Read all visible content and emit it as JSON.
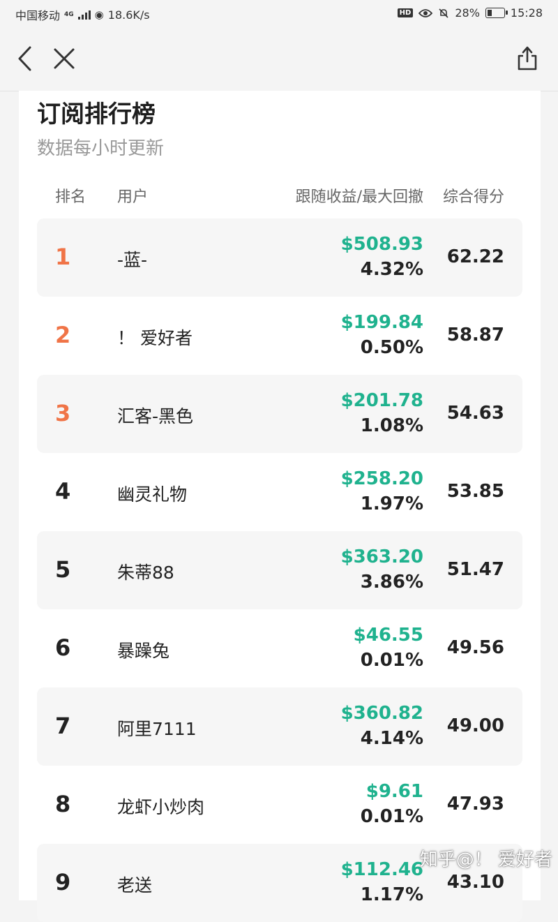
{
  "status_bar": {
    "carrier": "中国移动",
    "network_type": "4G",
    "speed": "18.6K/s",
    "hd_badge": "HD",
    "battery": "28%",
    "time": "15:28"
  },
  "nav": {
    "back_icon": "chevron-left-icon",
    "close_icon": "close-icon",
    "share_icon": "share-icon"
  },
  "page": {
    "title": "订阅排行榜",
    "subtitle": "数据每小时更新"
  },
  "table": {
    "headers": {
      "rank": "排名",
      "user": "用户",
      "perf": "跟随收益/最大回撤",
      "score": "综合得分"
    },
    "rows": [
      {
        "rank": "1",
        "user": "-蓝-",
        "gain": "$508.93",
        "drawdown": "4.32%",
        "score": "62.22"
      },
      {
        "rank": "2",
        "user": "！ 爱好者",
        "gain": "$199.84",
        "drawdown": "0.50%",
        "score": "58.87"
      },
      {
        "rank": "3",
        "user": "汇客-黑色",
        "gain": "$201.78",
        "drawdown": "1.08%",
        "score": "54.63"
      },
      {
        "rank": "4",
        "user": "幽灵礼物",
        "gain": "$258.20",
        "drawdown": "1.97%",
        "score": "53.85"
      },
      {
        "rank": "5",
        "user": "朱蒂88",
        "gain": "$363.20",
        "drawdown": "3.86%",
        "score": "51.47"
      },
      {
        "rank": "6",
        "user": "暴躁兔",
        "gain": "$46.55",
        "drawdown": "0.01%",
        "score": "49.56"
      },
      {
        "rank": "7",
        "user": "阿里7111",
        "gain": "$360.82",
        "drawdown": "4.14%",
        "score": "49.00"
      },
      {
        "rank": "8",
        "user": "龙虾小炒肉",
        "gain": "$9.61",
        "drawdown": "0.01%",
        "score": "47.93"
      },
      {
        "rank": "9",
        "user": "老送",
        "gain": "$112.46",
        "drawdown": "1.17%",
        "score": "43.10"
      }
    ]
  },
  "watermark": "知乎@！ 爱好者",
  "colors": {
    "gain": "#1fb28e",
    "top_rank": "#f07447",
    "row_shade": "#f6f6f6",
    "background": "#f4f4f4"
  }
}
